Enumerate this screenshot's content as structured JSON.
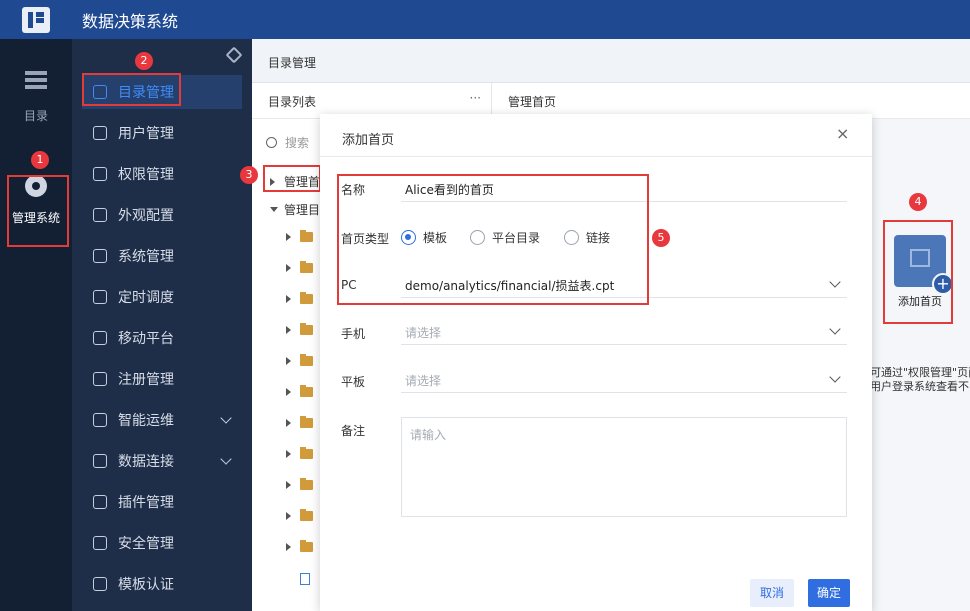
{
  "app": {
    "title": "数据决策系统"
  },
  "rail": {
    "dir_label": "目录",
    "sys_label": "管理系统"
  },
  "nav": {
    "items": [
      {
        "label": "目录管理"
      },
      {
        "label": "用户管理"
      },
      {
        "label": "权限管理"
      },
      {
        "label": "外观配置"
      },
      {
        "label": "系统管理"
      },
      {
        "label": "定时调度"
      },
      {
        "label": "移动平台"
      },
      {
        "label": "注册管理"
      },
      {
        "label": "智能运维"
      },
      {
        "label": "数据连接"
      },
      {
        "label": "插件管理"
      },
      {
        "label": "安全管理"
      },
      {
        "label": "模板认证"
      }
    ]
  },
  "content": {
    "header": "目录管理",
    "tree_title": "目录列表",
    "tree_menu": "···",
    "search_placeholder": "搜索",
    "tree_root": "管理首",
    "tree_sub": "管理目",
    "home_title": "管理首页",
    "add_home_label": "添加首页",
    "hint_line1": "可通过\"权限管理\"页面",
    "hint_line2": "用户登录系统查看不"
  },
  "modal": {
    "title": "添加首页",
    "close": "×",
    "name_label": "名称",
    "name_value": "Alice看到的首页",
    "type_label": "首页类型",
    "type_options": [
      "模板",
      "平台目录",
      "链接"
    ],
    "type_selected": "模板",
    "pc_label": "PC",
    "pc_value": "demo/analytics/financial/损益表.cpt",
    "phone_label": "手机",
    "phone_placeholder": "请选择",
    "tablet_label": "平板",
    "tablet_placeholder": "请选择",
    "note_label": "备注",
    "note_placeholder": "请输入",
    "cancel": "取消",
    "ok": "确定"
  },
  "annotations": [
    "1",
    "2",
    "3",
    "4",
    "5"
  ],
  "colors": {
    "topbar": "#1f4a92",
    "rail": "#131f33",
    "nav": "#1e2d48",
    "accent": "#2f6de0",
    "highlight": "#e23c39"
  }
}
